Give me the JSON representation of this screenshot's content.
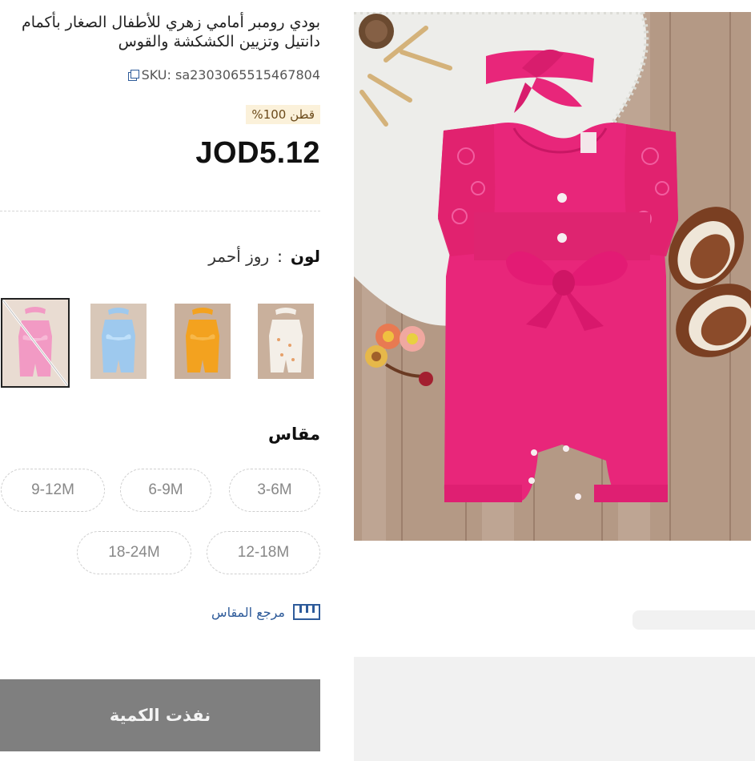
{
  "product": {
    "title_line1": "بودي رومبر أمامي زهري للأطفال الصغار بأكمام",
    "title_line2": "دانتيل وتزيين الكشكشة والقوس",
    "sku": "SKU: sa2303065515467804",
    "material_badge": "قطن 100%",
    "price": "JOD5.12"
  },
  "color": {
    "label": "لون",
    "separator": ":",
    "selected": "روز أحمر",
    "swatches": [
      {
        "name": "white-floral",
        "color": "#f4efe8",
        "accent": "#e6a06a"
      },
      {
        "name": "orange",
        "color": "#f3a21f",
        "accent": "#f7b84a"
      },
      {
        "name": "blue",
        "color": "#9ec9ee",
        "accent": "#bfe0fa"
      },
      {
        "name": "pink",
        "color": "#f29ac4",
        "accent": "#f7b9d6",
        "selected": true
      }
    ]
  },
  "size": {
    "label": "مقاس",
    "options": [
      "3-6M",
      "6-9M",
      "9-12M",
      "12-18M",
      "18-24M"
    ]
  },
  "size_guide": {
    "label": "مرجع المقاس",
    "icon": "ruler-icon"
  },
  "cta": {
    "label": "نفذت الكمية",
    "color": "#7f7f7f"
  },
  "theme": {
    "accent": "#2e5b9a",
    "product_pink": "#e8267a"
  }
}
